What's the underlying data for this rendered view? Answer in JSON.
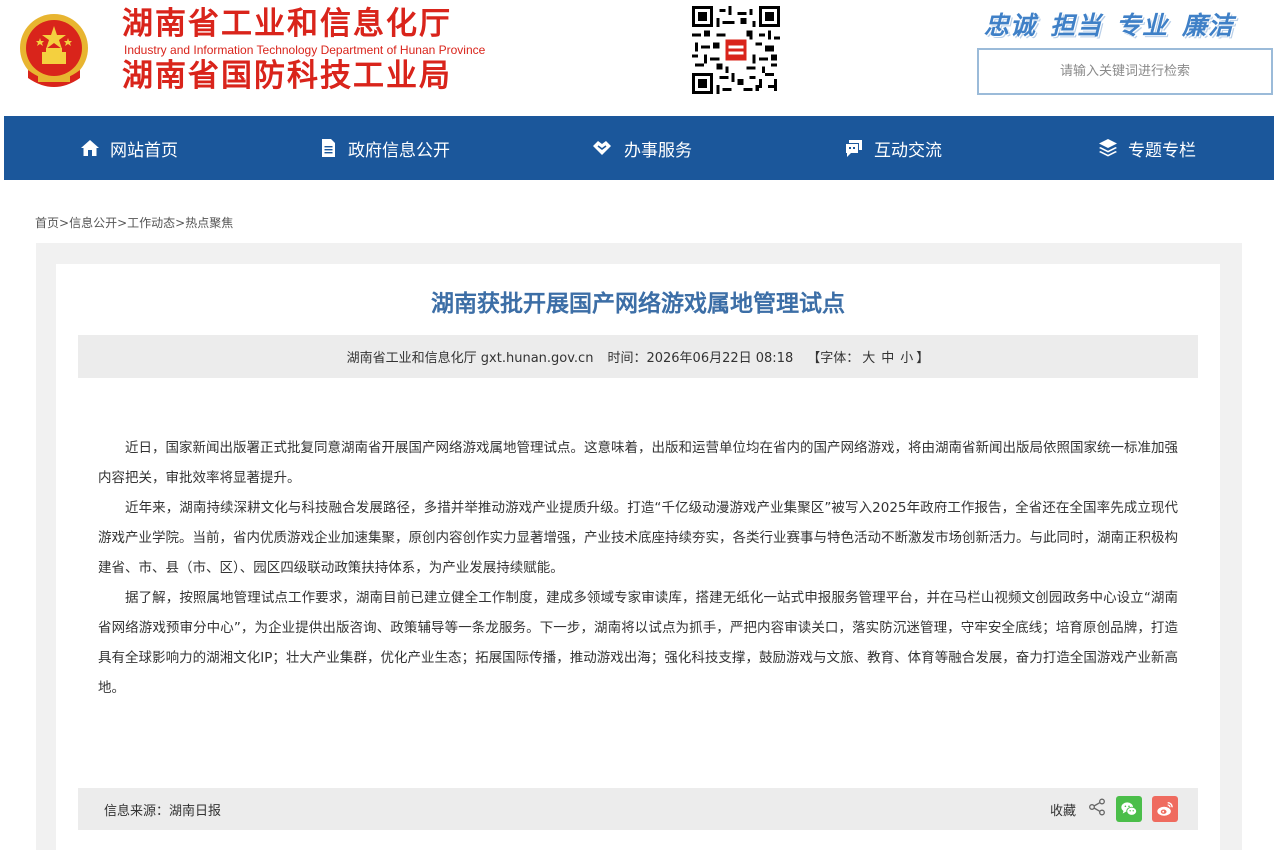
{
  "header": {
    "title_line1": "湖南省工业和信息化厅",
    "title_en": "Industry and Information Technology Department of Hunan Province",
    "title_line2": "湖南省国防科技工业局",
    "slogans": [
      "忠诚",
      "担当",
      "专业",
      "廉洁"
    ],
    "search_placeholder": "请输入关键词进行检索",
    "emblem_icon": "national-emblem-icon",
    "qr_icon": "qr-code-icon"
  },
  "nav": {
    "items": [
      {
        "label": "网站首页",
        "icon": "home-icon"
      },
      {
        "label": "政府信息公开",
        "icon": "document-icon"
      },
      {
        "label": "办事服务",
        "icon": "service-icon"
      },
      {
        "label": "互动交流",
        "icon": "chat-icon"
      },
      {
        "label": "专题专栏",
        "icon": "layers-icon"
      }
    ]
  },
  "breadcrumb": [
    "首页",
    "信息公开",
    "工作动态",
    "热点聚焦"
  ],
  "article": {
    "title": "湖南获批开展国产网络游戏属地管理试点",
    "publisher": "湖南省工业和信息化厅 gxt.hunan.gov.cn",
    "time_label": "时间：",
    "time": "2026年06月22日 08:18",
    "font_label_open": "【字体：",
    "font_large": "大",
    "font_medium": "中",
    "font_small": "小",
    "font_label_close": "】",
    "paragraphs": [
      "近日，国家新闻出版署正式批复同意湖南省开展国产网络游戏属地管理试点。这意味着，出版和运营单位均在省内的国产网络游戏，将由湖南省新闻出版局依照国家统一标准加强内容把关，审批效率将显著提升。",
      "近年来，湖南持续深耕文化与科技融合发展路径，多措并举推动游戏产业提质升级。打造“千亿级动漫游戏产业集聚区”被写入2025年政府工作报告，全省还在全国率先成立现代游戏产业学院。当前，省内优质游戏企业加速集聚，原创内容创作实力显著增强，产业技术底座持续夯实，各类行业赛事与特色活动不断激发市场创新活力。与此同时，湖南正积极构建省、市、县（市、区）、园区四级联动政策扶持体系，为产业发展持续赋能。",
      "据了解，按照属地管理试点工作要求，湖南目前已建立健全工作制度，建成多领域专家审读库，搭建无纸化一站式申报服务管理平台，并在马栏山视频文创园政务中心设立“湖南省网络游戏预审分中心”，为企业提供出版咨询、政策辅导等一条龙服务。下一步，湖南将以试点为抓手，严把内容审读关口，落实防沉迷管理，守牢安全底线；培育原创品牌，打造具有全球影响力的湖湘文化IP；壮大产业集群，优化产业生态；拓展国际传播，推动游戏出海；强化科技支撑，鼓励游戏与文旅、教育、体育等融合发展，奋力打造全国游戏产业新高地。"
    ],
    "source": "信息来源：湖南日报",
    "favorite": "收藏"
  },
  "colors": {
    "brand_red": "#d9241b",
    "nav_blue": "#1b579b",
    "title_blue": "#3c6ea6",
    "slogan_blue": "#3f80c7"
  }
}
